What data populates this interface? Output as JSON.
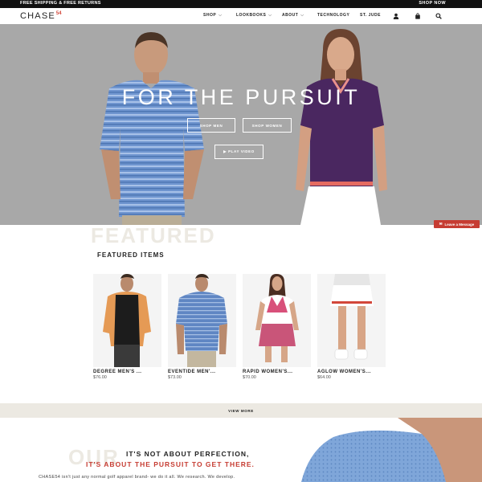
{
  "promo": {
    "text": "FREE SHIPPING & FREE RETURNS",
    "shop_now": "SHOP NOW"
  },
  "header": {
    "logo_word": "CHASE",
    "logo_num": "54",
    "nav": [
      {
        "label": "SHOP",
        "caret": "⌵"
      },
      {
        "label": "LOOKBOOKS",
        "caret": "⌵"
      },
      {
        "label": "ABOUT",
        "caret": "⌵"
      },
      {
        "label": "TECHNOLOGY"
      },
      {
        "label": "ST. JUDE"
      }
    ],
    "icons": [
      "account-icon",
      "cart-icon",
      "search-icon"
    ]
  },
  "hero": {
    "title": "FOR THE PURSUIT",
    "shop_men": "SHOP MEN",
    "shop_women": "SHOP WOMEN",
    "play_video": "▶ PLAY VIDEO"
  },
  "leave_message": "Leave a Message",
  "featured": {
    "bg_text": "FEATURED",
    "title": "FEATURED ITEMS",
    "products": [
      {
        "name": "DEGREE MEN'S ...",
        "price": "$76.00"
      },
      {
        "name": "EVENTIDE MEN'...",
        "price": "$73.00"
      },
      {
        "name": "RAPID WOMEN'S...",
        "price": "$70.00"
      },
      {
        "name": "AGLOW WOMEN'S...",
        "price": "$64.00"
      }
    ],
    "view_more": "VIEW MORE"
  },
  "story": {
    "bg_text": "OUR",
    "line1": "IT'S NOT ABOUT PERFECTION,",
    "line2": "IT'S ABOUT THE PURSUIT TO GET THERE.",
    "paragraph": "CHASE54 isn't just any normal golf apparel brand- we do it all. We research. We develop."
  },
  "colors": {
    "accent": "#c63c32",
    "hero_bg": "#a8a8a8",
    "band": "#ece9e2"
  }
}
